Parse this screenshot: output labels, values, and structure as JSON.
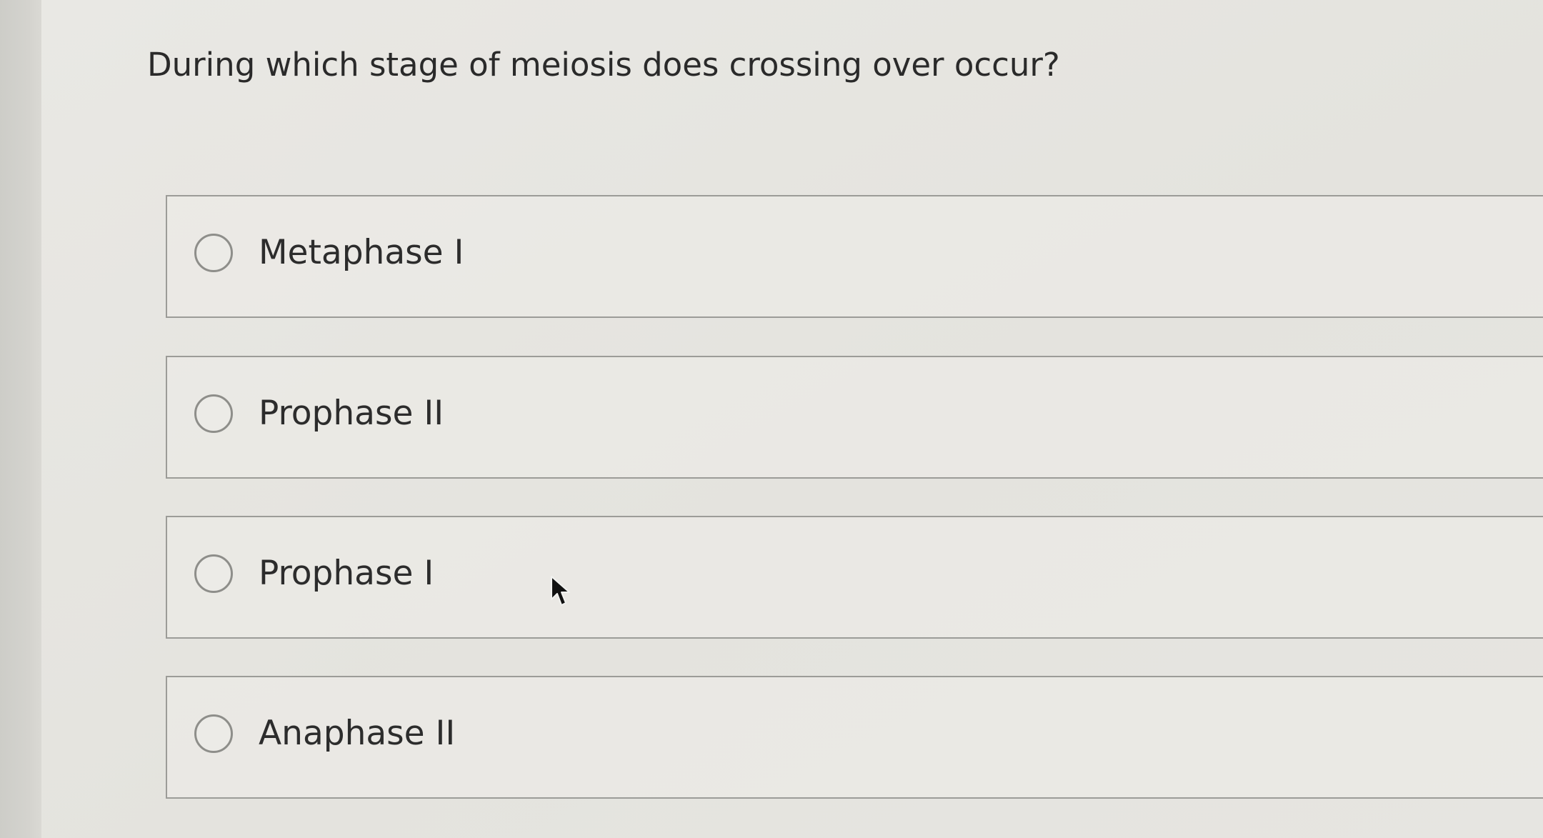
{
  "question": {
    "text": "During which stage of meiosis does crossing over occur?"
  },
  "options": [
    {
      "label": "Metaphase I",
      "selected": false
    },
    {
      "label": "Prophase II",
      "selected": false
    },
    {
      "label": "Prophase I",
      "selected": false
    },
    {
      "label": "Anaphase II",
      "selected": false
    }
  ],
  "icons": {
    "radio": "radio-unselected-icon",
    "cursor": "mouse-pointer-icon"
  },
  "colors": {
    "background": "#e4e3de",
    "border": "#9c9c98",
    "text": "#2c2c2c"
  }
}
